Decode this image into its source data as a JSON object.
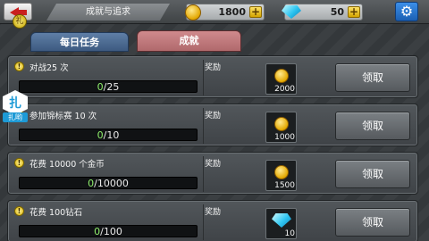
{
  "header": {
    "title": "成就与追求",
    "gold": "1800",
    "gems": "50",
    "plus": "+",
    "gift_badge": "礼"
  },
  "side_button": {
    "label": "扎哟",
    "glyph": "扎"
  },
  "tabs": [
    {
      "label": "每日任务",
      "active": false
    },
    {
      "label": "成就",
      "active": true
    }
  ],
  "reward_label": "奖励",
  "claim_label": "领取",
  "tasks": [
    {
      "title": "对战25 次",
      "current": "0",
      "total": "25",
      "reward_type": "gold",
      "reward_amount": "2000"
    },
    {
      "title": "参加锦标赛  10  次",
      "current": "0",
      "total": "10",
      "reward_type": "gold",
      "reward_amount": "1000"
    },
    {
      "title": "花费 10000 个金币",
      "current": "0",
      "total": "10000",
      "reward_type": "gold",
      "reward_amount": "1500"
    },
    {
      "title": "花费 100钻石",
      "current": "0",
      "total": "100",
      "reward_type": "gem",
      "reward_amount": "10"
    }
  ],
  "colors": {
    "accent_blue": "#1b5fb3",
    "active_tab": "#b0696c",
    "progress_green": "#8fef6c",
    "gold": "#e2a700"
  }
}
